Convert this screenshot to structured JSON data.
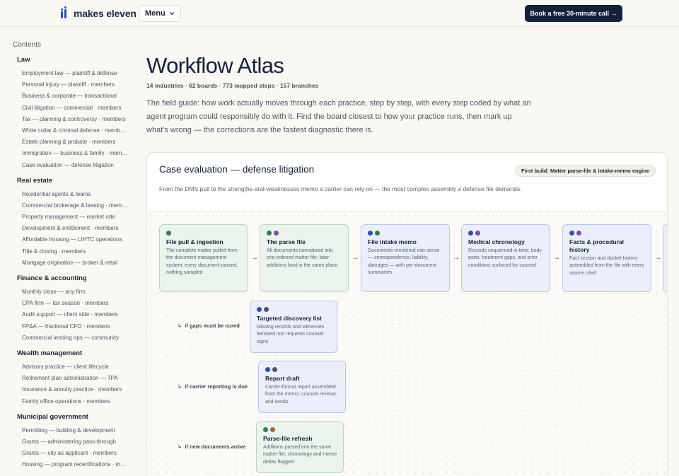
{
  "header": {
    "brand": "makes eleven",
    "menu_label": "Menu",
    "cta_label": "Book a free 30-minute call →"
  },
  "sidebar": {
    "title": "Contents",
    "sections": [
      {
        "title": "Law",
        "items": [
          "Employment law — plaintiff & defense",
          "Personal injury — plaintiff · members",
          "Business & corporate — transactional",
          "Civil litigation — commercial · members",
          "Tax — planning & controversy · members",
          "White collar & criminal defense · members",
          "Estate planning & probate · members",
          "Immigration — business & family · members",
          "Case evaluation — defense litigation"
        ]
      },
      {
        "title": "Real estate",
        "items": [
          "Residential agents & teams",
          "Commercial brokerage & leasing · members",
          "Property management — market rate",
          "Development & entitlement · members",
          "Affordable housing — LIHTC operations",
          "Title & closing · members",
          "Mortgage origination — broker & retail"
        ]
      },
      {
        "title": "Finance & accounting",
        "items": [
          "Monthly close — any firm",
          "CPA firm — tax season · members",
          "Audit support — client side · members",
          "FP&A — fractional CFO · members",
          "Commercial lending ops — community"
        ]
      },
      {
        "title": "Wealth management",
        "items": [
          "Advisory practice — client lifecycle",
          "Retirement plan administration — TPA",
          "Insurance & annuity practice · members",
          "Family office operations · members"
        ]
      },
      {
        "title": "Municipal government",
        "items": [
          "Permitting — building & development",
          "Grants — administering pass-through",
          "Grants — city as applicant · members",
          "Housing — program recertifications · members"
        ]
      }
    ]
  },
  "main": {
    "title": "Workflow Atlas",
    "stats": "14 industries · 62 boards · 773 mapped steps · 157 branches",
    "intro": "The field guide: how work actually moves through each practice, step by step, with every step coded by what an agent program could responsibly do with it. Find the board closest to how your practice runs, then mark up what's wrong — the corrections are the fastest diagnostic there is."
  },
  "board": {
    "title": "Case evaluation — defense litigation",
    "badge": "First build: Matter parse-file & intake-memo engine",
    "description": "From the DMS pull to the strengths-and-weaknesses memo a carrier can rely on — the most complex assembly a defense file demands.",
    "arrow_glyph": "→",
    "branch_glyph": "↳",
    "colors": {
      "green": "#2f7d4f",
      "blue": "#2a4fb8",
      "purple": "#7a4fb0",
      "slate": "#4a5468",
      "brown": "#a0673a"
    },
    "steps": [
      {
        "title": "File pull & ingestion",
        "desc": "The complete matter pulled from the document management system; every document parsed, nothing sampled",
        "tone": "green",
        "dots": [
          "green"
        ]
      },
      {
        "title": "The parse file",
        "desc": "All documents normalized into one indexed matter file; later additions land in the same place",
        "tone": "green",
        "dots": [
          "green",
          "purple"
        ]
      },
      {
        "title": "File intake memo",
        "desc": "Documents reordered into sense — correspondence, liability, damages — with per-document summaries",
        "tone": "blue",
        "dots": [
          "blue",
          "green"
        ]
      },
      {
        "title": "Medical chronology",
        "desc": "Records sequenced in time; body parts, treatment gaps, and prior conditions surfaced for counsel",
        "tone": "blue",
        "dots": [
          "blue",
          "purple"
        ]
      },
      {
        "title": "Facts & procedural history",
        "desc": "Fact section and docket history assembled from the file with every source cited",
        "tone": "blue",
        "dots": [
          "blue",
          "purple"
        ]
      }
    ],
    "branches": [
      {
        "label": "if gaps must be cured",
        "title": "Targeted discovery list",
        "desc": "Missing records and witnesses itemized into requests counsel signs",
        "tone": "blue",
        "dots": [
          "blue",
          "slate"
        ]
      },
      {
        "label": "if carrier reporting is due",
        "title": "Report draft",
        "desc": "Carrier-format report assembled from the memo; counsel reviews and sends",
        "tone": "blue",
        "dots": [
          "blue",
          "slate"
        ]
      },
      {
        "label": "if new documents arrive",
        "title": "Parse-file refresh",
        "desc": "Additions parsed into the same matter file; chronology and memo deltas flagged",
        "tone": "green",
        "dots": [
          "green",
          "brown"
        ]
      }
    ]
  }
}
